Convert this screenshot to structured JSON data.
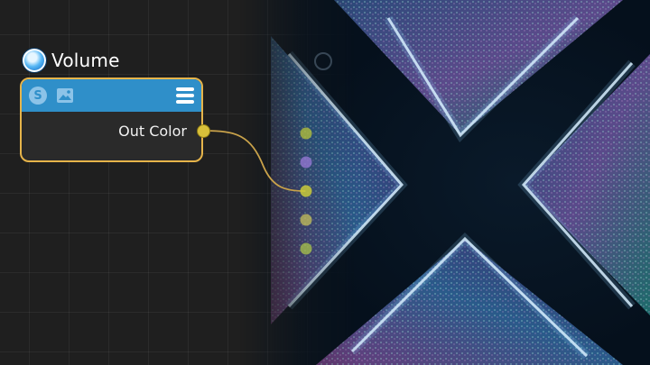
{
  "node": {
    "title": "Volume",
    "output_label": "Out Color",
    "icons": [
      "volume-orb-icon",
      "shader-s-icon",
      "image-icon",
      "menu-icon"
    ],
    "shader_glyph": "S"
  },
  "colors": {
    "canvas_bg": "#1f1f1f",
    "node_border": "#e6b44a",
    "node_header": "#2f8fc9",
    "node_body": "#2a2a2a",
    "port": "#d8c03a",
    "wire": "#c9a24a"
  },
  "target_node": {
    "input_port_count": 5,
    "connected_input_index": 2
  }
}
